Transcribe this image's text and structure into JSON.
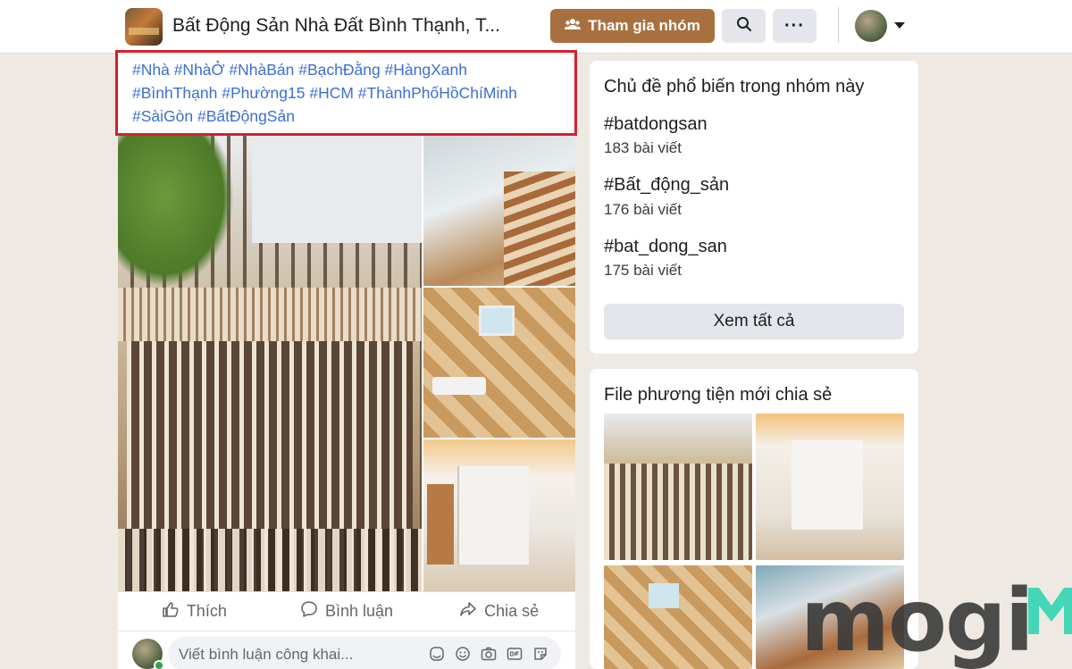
{
  "header": {
    "group_title": "Bất Động Sản Nhà Đất Bình Thạnh, T...",
    "join_label": "Tham gia nhóm",
    "more_label": "···"
  },
  "post": {
    "hashtag_lines": [
      "#Nhà #NhàỞ #NhàBán #BạchĐằng #HàngXanh",
      "#BìnhThạnh #Phường15 #HCM #ThànhPhốHồChíMinh",
      "#SàiGòn #BấtĐộngSản"
    ],
    "actions": {
      "like": "Thích",
      "comment": "Bình luận",
      "share": "Chia sẻ"
    },
    "comment_placeholder": "Viết bình luận công khai..."
  },
  "topics": {
    "title": "Chủ đề phổ biến trong nhóm này",
    "items": [
      {
        "name": "#batdongsan",
        "count": "183 bài viết"
      },
      {
        "name": "#Bất_động_sản",
        "count": "176 bài viết"
      },
      {
        "name": "#bat_dong_san",
        "count": "175 bài viết"
      }
    ],
    "see_all": "Xem tất cả"
  },
  "media": {
    "title": "File phương tiện mới chia sẻ"
  },
  "watermark": {
    "text": "mogi"
  },
  "colors": {
    "join_button": "#a8703f",
    "hashtag": "#3b6fd1",
    "highlight_border": "#d81f2a",
    "watermark_accent": "#3ad6b4",
    "page_bg": "#efe9e3"
  }
}
